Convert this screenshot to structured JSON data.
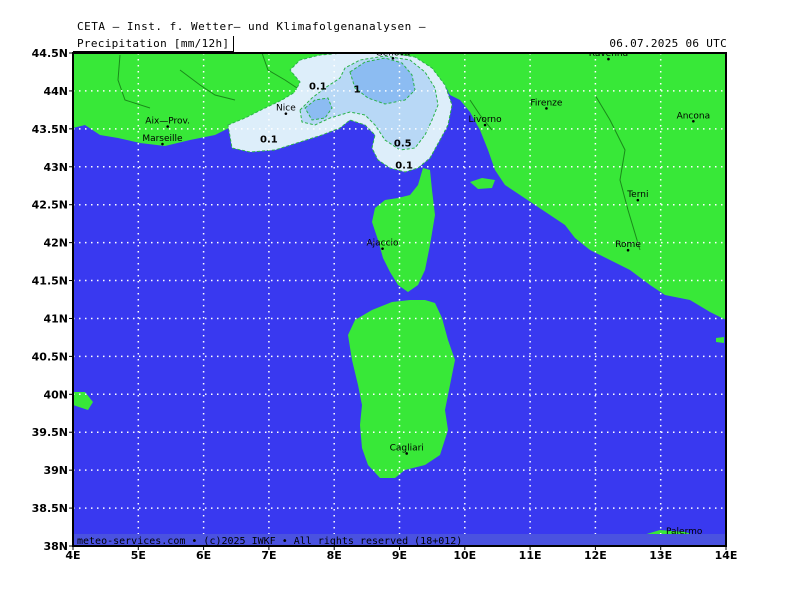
{
  "header": {
    "title": "CETA — Inst. f. Wetter— und Klimafolgenanalysen —",
    "parameter": "Precipitation [mm/12h]",
    "valid_time": "06.07.2025 06 UTC"
  },
  "footer": {
    "copyright": "meteo-services.com • (c)2025 IWKF • All rights reserved (18+012)"
  },
  "axes": {
    "lon_labels": [
      "4E",
      "5E",
      "6E",
      "7E",
      "8E",
      "9E",
      "10E",
      "11E",
      "12E",
      "13E",
      "14E"
    ],
    "lat_labels": [
      "44.5N",
      "44N",
      "43.5N",
      "43N",
      "42.5N",
      "42N",
      "41.5N",
      "41N",
      "40.5N",
      "40N",
      "39.5N",
      "39N",
      "38.5N",
      "38N"
    ]
  },
  "cities": [
    {
      "name": "Genova",
      "lon": 8.9,
      "lat": 44.43
    },
    {
      "name": "Ravenna",
      "lon": 12.2,
      "lat": 44.42
    },
    {
      "name": "Nice",
      "lon": 7.26,
      "lat": 43.7
    },
    {
      "name": "Firenze",
      "lon": 11.25,
      "lat": 43.77
    },
    {
      "name": "Aix—Prov.",
      "lon": 5.45,
      "lat": 43.53
    },
    {
      "name": "Ancona",
      "lon": 13.5,
      "lat": 43.6
    },
    {
      "name": "Livorno",
      "lon": 10.31,
      "lat": 43.55
    },
    {
      "name": "Marseille",
      "lon": 5.37,
      "lat": 43.3
    },
    {
      "name": "Terni",
      "lon": 12.65,
      "lat": 42.56
    },
    {
      "name": "Ajaccio",
      "lon": 8.74,
      "lat": 41.92
    },
    {
      "name": "Rome",
      "lon": 12.5,
      "lat": 41.9
    },
    {
      "name": "Cagliari",
      "lon": 9.11,
      "lat": 39.22
    },
    {
      "name": "Palermo",
      "lon": 13.36,
      "lat": 38.12
    }
  ],
  "contour_labels": [
    {
      "text": "0.1",
      "lon": 7.75,
      "lat": 44.02
    },
    {
      "text": "1",
      "lon": 8.35,
      "lat": 43.98
    },
    {
      "text": "0.1",
      "lon": 7.0,
      "lat": 43.32
    },
    {
      "text": "0.5",
      "lon": 9.05,
      "lat": 43.27
    },
    {
      "text": "0.1",
      "lon": 9.07,
      "lat": 42.98
    }
  ],
  "colors": {
    "sea": "#3939f0",
    "land": "#38e838",
    "precip_0.1": "#ddeefa",
    "precip_0.5": "#b8d8f6",
    "precip_1": "#8cbcf2",
    "grid": "#ffffff",
    "city_dot": "#000000",
    "footer_bar": "#4a52e0"
  }
}
